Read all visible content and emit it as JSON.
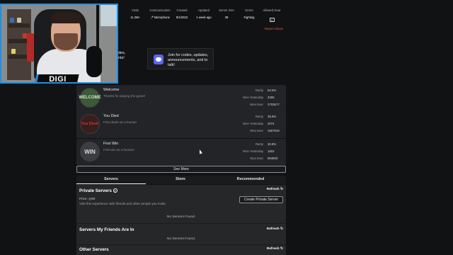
{
  "stats": [
    {
      "label": "Visits",
      "value": "11.2M+"
    },
    {
      "label": "Communication",
      "value": "Microphone"
    },
    {
      "label": "Created",
      "value": "9/1/2022"
    },
    {
      "label": "Updated",
      "value": "1 week ago"
    },
    {
      "label": "Server Size",
      "value": "38"
    },
    {
      "label": "Genre",
      "value": "Fighting"
    },
    {
      "label": "Allowed Gear",
      "value": "X"
    }
  ],
  "report_link": "Report Abuse",
  "social": {
    "left_partial": "odes,\nents!",
    "right_text": "Join for codes, updates, announcements, and to talk!",
    "icon": "discord-icon"
  },
  "badges": [
    {
      "title": "Welcome",
      "desc": "Thanks for playing the game!",
      "icon_text": "WELCOME",
      "icon_color": "#3a5a3a",
      "text_color": "#d8e6c0",
      "rarity": "63.6%",
      "won_yesterday": "3306",
      "won_ever": "2703677"
    },
    {
      "title": "You Died",
      "desc": "First death as a human",
      "icon_text": "You Died!",
      "icon_color": "#3a1d1d",
      "text_color": "#c23b2e",
      "rarity": "39.9%",
      "won_yesterday": "2074",
      "won_ever": "1507915"
    },
    {
      "title": "First Win",
      "desc": "First win as a human!",
      "icon_text": "WIN",
      "icon_color": "#3b3d40",
      "text_color": "#d8dadd",
      "rarity": "30.8%",
      "won_yesterday": "1602",
      "won_ever": "904600"
    }
  ],
  "badge_labels": {
    "rarity": "Rarity",
    "won_yesterday": "Won Yesterday",
    "won_ever": "Won Ever"
  },
  "see_more": "See More",
  "tabs": [
    "Servers",
    "Store",
    "Recommended"
  ],
  "servers": {
    "private_title": "Private Servers",
    "refresh": "Refresh",
    "price_label": "Price:",
    "price_value": "99",
    "visit_text": "Visit this experience with friends and other people you invite.",
    "create_button": "Create Private Server",
    "none_found": "No Servers Found.",
    "friends_title": "Servers My Friends Are In",
    "other_title": "Other Servers"
  },
  "streamer": {
    "name": "DIGI",
    "accent": "#1e8fe6"
  }
}
